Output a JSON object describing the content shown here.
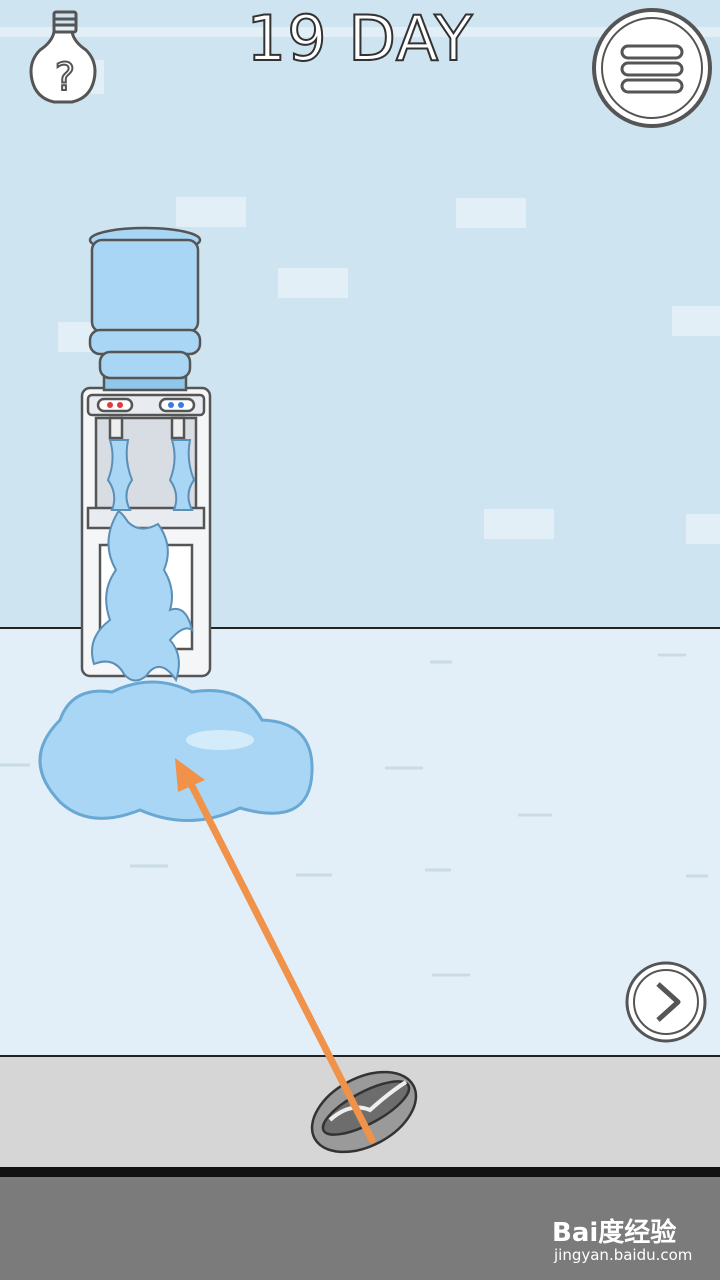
{
  "header": {
    "day_label": "19 DAY"
  },
  "buttons": {
    "hint_icon": "lightbulb-question-icon",
    "menu_icon": "hamburger-menu-icon",
    "next_icon": "chevron-right-icon"
  },
  "scene": {
    "objects": [
      "water-cooler",
      "water-puddle",
      "hot-dog"
    ],
    "annotation_arrow_color": "#f0924a",
    "wall_color": "#cfe4f1",
    "floor_color": "#e2eff8",
    "water_color": "#a9d6f5"
  },
  "watermark": {
    "logo": "Bai度经验",
    "site": "jingyan.baidu.com"
  }
}
